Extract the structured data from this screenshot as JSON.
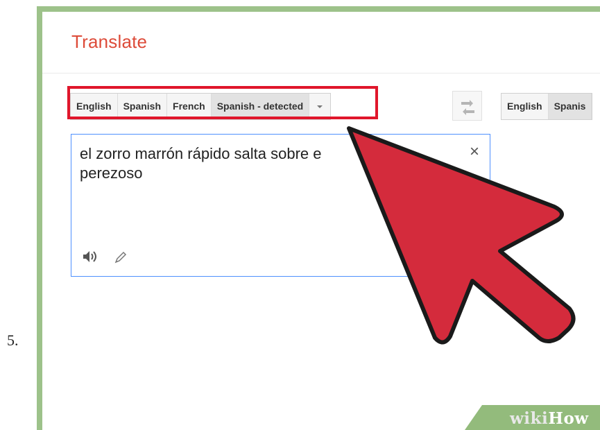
{
  "step": {
    "number": "5."
  },
  "header": {
    "title": "Translate"
  },
  "source_langs": {
    "items": [
      "English",
      "Spanish",
      "French",
      "Spanish - detected"
    ],
    "dropdown_icon": "chevron-down-icon"
  },
  "target_langs": {
    "items": [
      "English",
      "Spanis"
    ]
  },
  "swap": {
    "icon": "swap-arrows-icon"
  },
  "input": {
    "value": "el zorro marrón rápido salta sobre el perro\nperezoso",
    "visible_line1": "el zorro marrón rápido salta sobre e",
    "visible_line2": "perezoso",
    "clear_icon": "×"
  },
  "watermark": {
    "wiki": "wiki",
    "how": "How"
  },
  "colors": {
    "accent_title": "#dd4b39",
    "highlight": "#e0162b",
    "arrow": "#d42b3c",
    "frame": "#9dc28a",
    "input_border": "#4d90fe"
  }
}
